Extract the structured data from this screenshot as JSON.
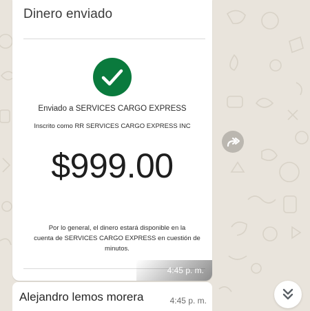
{
  "message": {
    "title": "Dinero enviado",
    "sent_to": "Enviado a SERVICES CARGO EXPRESS",
    "registered_as": "Inscrito como RR SERVICES CARGO EXPRESS INC",
    "amount": "$999.00",
    "note_line1": "Por lo general, el dinero estará disponible en la",
    "note_line2": "cuenta de SERVICES CARGO EXPRESS en cuestión de",
    "note_line3": "minutos.",
    "image_time": "4:45 p. m."
  },
  "caption": {
    "text": "Alejandro lemos morera",
    "time": "4:45 p. m."
  },
  "icons": {
    "check": "check-circle-icon",
    "forward": "forward-icon",
    "scroll_down": "double-chevron-down-icon"
  },
  "colors": {
    "success_green": "#0a7a3d",
    "chat_background": "#e9e4dc",
    "bubble": "#ffffff"
  }
}
